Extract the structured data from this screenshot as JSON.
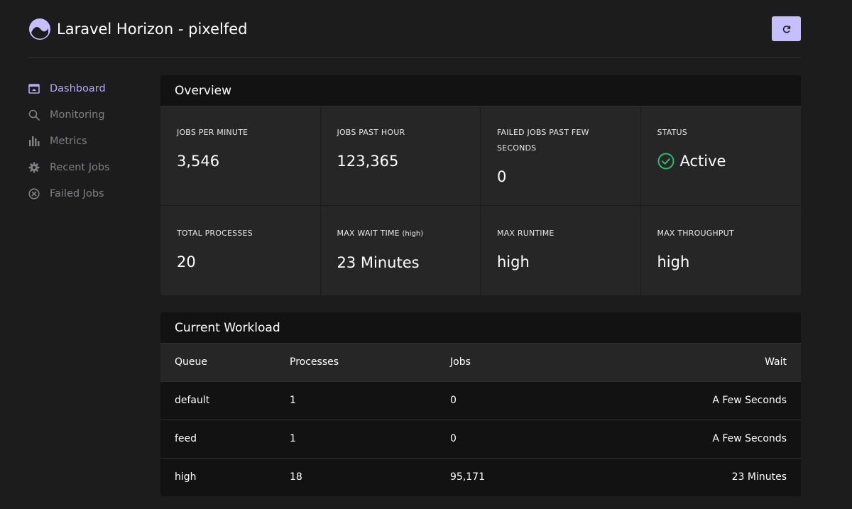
{
  "header": {
    "title": "Laravel Horizon - pixelfed"
  },
  "colors": {
    "accent": "#b3aaf8",
    "button_bg": "#c5bfff",
    "success": "#21c16b",
    "background": "#1c1c1d",
    "card": "#262627"
  },
  "sidebar": {
    "items": [
      {
        "label": "Dashboard",
        "icon": "dashboard-icon",
        "active": true
      },
      {
        "label": "Monitoring",
        "icon": "search-icon",
        "active": false
      },
      {
        "label": "Metrics",
        "icon": "bar-chart-icon",
        "active": false
      },
      {
        "label": "Recent Jobs",
        "icon": "gear-icon",
        "active": false
      },
      {
        "label": "Failed Jobs",
        "icon": "x-circle-icon",
        "active": false
      }
    ]
  },
  "overview": {
    "title": "Overview",
    "stats": [
      {
        "label": "JOBS PER MINUTE",
        "value": "3,546"
      },
      {
        "label": "JOBS PAST HOUR",
        "value": "123,365"
      },
      {
        "label": "FAILED JOBS PAST FEW SECONDS",
        "value": "0"
      },
      {
        "label": "STATUS",
        "value": "Active"
      },
      {
        "label": "TOTAL PROCESSES",
        "value": "20"
      },
      {
        "label": "MAX WAIT TIME",
        "sub": "(high)",
        "value": "23 Minutes"
      },
      {
        "label": "MAX RUNTIME",
        "value": "high"
      },
      {
        "label": "MAX THROUGHPUT",
        "value": "high"
      }
    ]
  },
  "workload": {
    "title": "Current Workload",
    "columns": [
      "Queue",
      "Processes",
      "Jobs",
      "Wait"
    ],
    "rows": [
      [
        "default",
        "1",
        "0",
        "A Few Seconds"
      ],
      [
        "feed",
        "1",
        "0",
        "A Few Seconds"
      ],
      [
        "high",
        "18",
        "95,171",
        "23 Minutes"
      ]
    ]
  }
}
